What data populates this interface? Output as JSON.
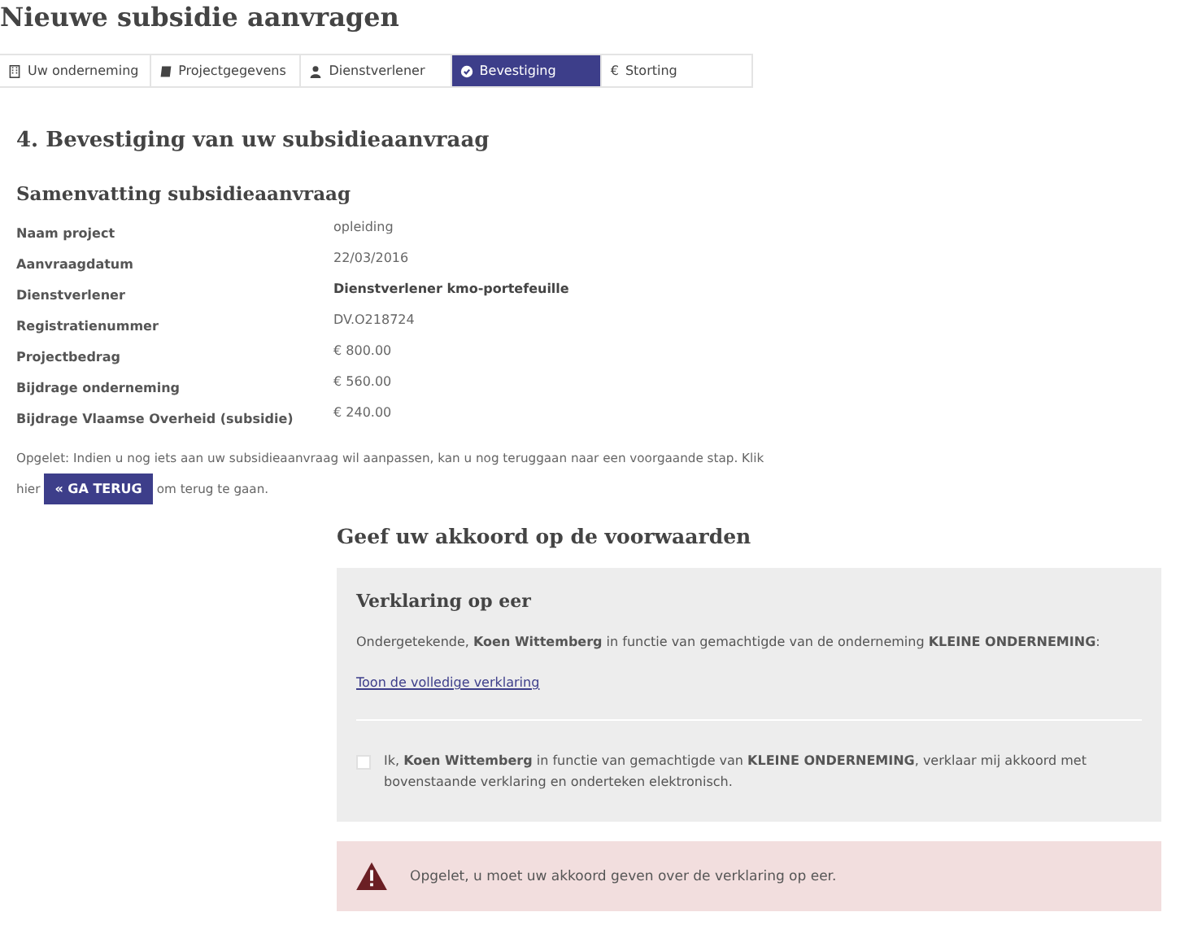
{
  "page_title": "Nieuwe subsidie aanvragen",
  "tabs": [
    {
      "label": "Uw onderneming",
      "kind": "building",
      "selected": false
    },
    {
      "label": "Projectgegevens",
      "kind": "book",
      "selected": false
    },
    {
      "label": "Dienstverlener",
      "kind": "person",
      "selected": false
    },
    {
      "label": "Bevestiging",
      "kind": "check",
      "selected": true
    },
    {
      "label": "€",
      "kind": "text",
      "selected": false,
      "text": "Storting"
    }
  ],
  "step_title": "4. Bevestiging van uw subsidieaanvraag",
  "summary": {
    "title": "Samenvatting subsidieaanvraag",
    "rows": [
      {
        "label": "Naam project",
        "value": "opleiding",
        "bold": false
      },
      {
        "label": "Aanvraagdatum",
        "value": "22/03/2016",
        "bold": false
      },
      {
        "label": "Dienstverlener",
        "value": "Dienstverlener kmo-portefeuille",
        "bold": true
      },
      {
        "label": "Registratienummer",
        "value": "DV.O218724",
        "bold": false
      },
      {
        "label": "Projectbedrag",
        "value": "€  800.00",
        "bold": false
      },
      {
        "label": "Bijdrage onderneming",
        "value": "€  560.00",
        "bold": false
      },
      {
        "label": "Bijdrage Vlaamse Overheid (subsidie)",
        "value": "€  240.00",
        "bold": false
      }
    ]
  },
  "note": {
    "text": "Opgelet: Indien u nog iets aan uw subsidieaanvraag wil aanpassen, kan u nog teruggaan naar een voorgaande stap. Klik",
    "before": "hier",
    "button": "« GA TERUG",
    "after": "om terug te gaan."
  },
  "agreement": {
    "title": "Geef uw akkoord op de voorwaarden",
    "box_title": "Verklaring op eer",
    "statement": "Ondergetekende, **Koen Wittemberg** in functie van gemachtigde van de onderneming **KLEINE ONDERNEMING**:",
    "link": "Toon de volledige verklaring",
    "checkbox": {
      "label": "Ik, **Koen Wittemberg** in functie van gemachtigde van **KLEINE ONDERNEMING**, verklaar mij akkoord met bovenstaande verklaring en onderteken elektronisch.",
      "checked": false
    }
  },
  "alert": "Opgelet, u moet uw akkoord geven over de verklaring op eer."
}
